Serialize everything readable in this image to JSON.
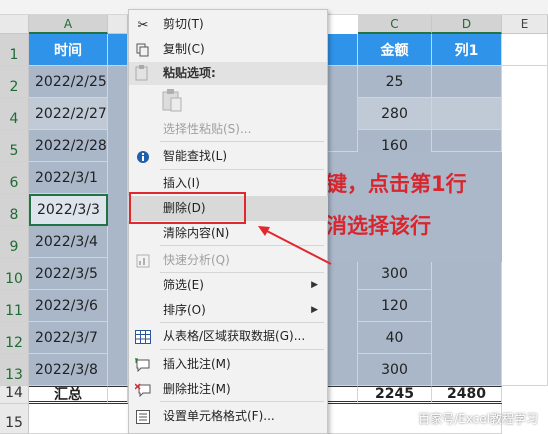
{
  "columns": {
    "a": "A",
    "c": "C",
    "d": "D",
    "e": "E"
  },
  "rows": [
    "1",
    "2",
    "4",
    "5",
    "6",
    "8",
    "9",
    "10",
    "11",
    "12",
    "13",
    "14",
    "15"
  ],
  "headers": {
    "time": "时间",
    "amount": "金额",
    "col1": "列1"
  },
  "dates": [
    "2022/2/25",
    "2022/2/27",
    "2022/2/28",
    "2022/3/1",
    "2022/3/3",
    "2022/3/4",
    "2022/3/5",
    "2022/3/6",
    "2022/3/7",
    "2022/3/8"
  ],
  "amounts": [
    "25",
    "280",
    "160",
    "",
    "",
    "",
    "300",
    "120",
    "40",
    "300"
  ],
  "total": {
    "label": "汇总",
    "amount": "2245",
    "col1": "2480"
  },
  "menu": {
    "cut": "剪切(T)",
    "copy": "复制(C)",
    "paste_options": "粘贴选项:",
    "paste_special": "选择性粘贴(S)...",
    "smart_lookup": "智能查找(L)",
    "insert": "插入(I)",
    "delete": "删除(D)",
    "clear": "清除内容(N)",
    "quick_analysis": "快速分析(Q)",
    "filter": "筛选(E)",
    "sort": "排序(O)",
    "get_data": "从表格/区域获取数据(G)...",
    "insert_comment": "插入批注(M)",
    "delete_comment": "删除批注(M)",
    "format_cells": "设置单元格格式(F)..."
  },
  "annotation": {
    "line1": "键，点击第1行",
    "line2": "消选择该行",
    "color": "#d8262f"
  },
  "watermark": "百家号/Excel教程学习",
  "colors": {
    "header_blue": "#2f93ea",
    "row_fill": "#a9b7c9",
    "highlight": "#e0282e"
  }
}
